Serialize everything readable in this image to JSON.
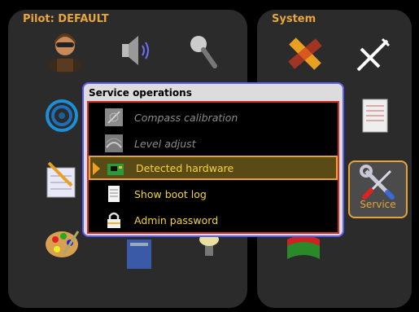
{
  "pilot_panel": {
    "title": "Pilot: DEFAULT",
    "icons": [
      "pilot-avatar-icon",
      "speaker-icon",
      "microphone-icon",
      "spiral-icon",
      "notepad-icon",
      "circuit-board-icon",
      "palette-icon",
      "lightbulb-icon"
    ]
  },
  "system_panel": {
    "title": "System",
    "icons": [
      "ruler-icon",
      "airplane-icon",
      "log-document-icon",
      "flag-icon"
    ],
    "service_tile": {
      "label": "Service",
      "icon": "wrench-screwdriver-icon",
      "selected": true
    }
  },
  "dialog": {
    "title": "Service operations",
    "items": [
      {
        "label": "Compass calibration",
        "icon": "compass-calibration-icon",
        "enabled": false,
        "selected": false
      },
      {
        "label": "Level adjust",
        "icon": "level-adjust-icon",
        "enabled": false,
        "selected": false
      },
      {
        "label": "Detected hardware",
        "icon": "hardware-board-icon",
        "enabled": true,
        "selected": true
      },
      {
        "label": "Show boot log",
        "icon": "document-icon",
        "enabled": true,
        "selected": false
      },
      {
        "label": "Admin password",
        "icon": "padlock-icon",
        "enabled": true,
        "selected": false
      }
    ]
  },
  "colors": {
    "background": "#000000",
    "panel": "#2b2b2b",
    "title_orange": "#e8a53c",
    "dialog_border": "#5c5cf2",
    "list_border": "#d12b2b",
    "selected_border": "#e6a33a",
    "item_text": "#f2d33a",
    "disabled_text": "#8c8c8c"
  }
}
